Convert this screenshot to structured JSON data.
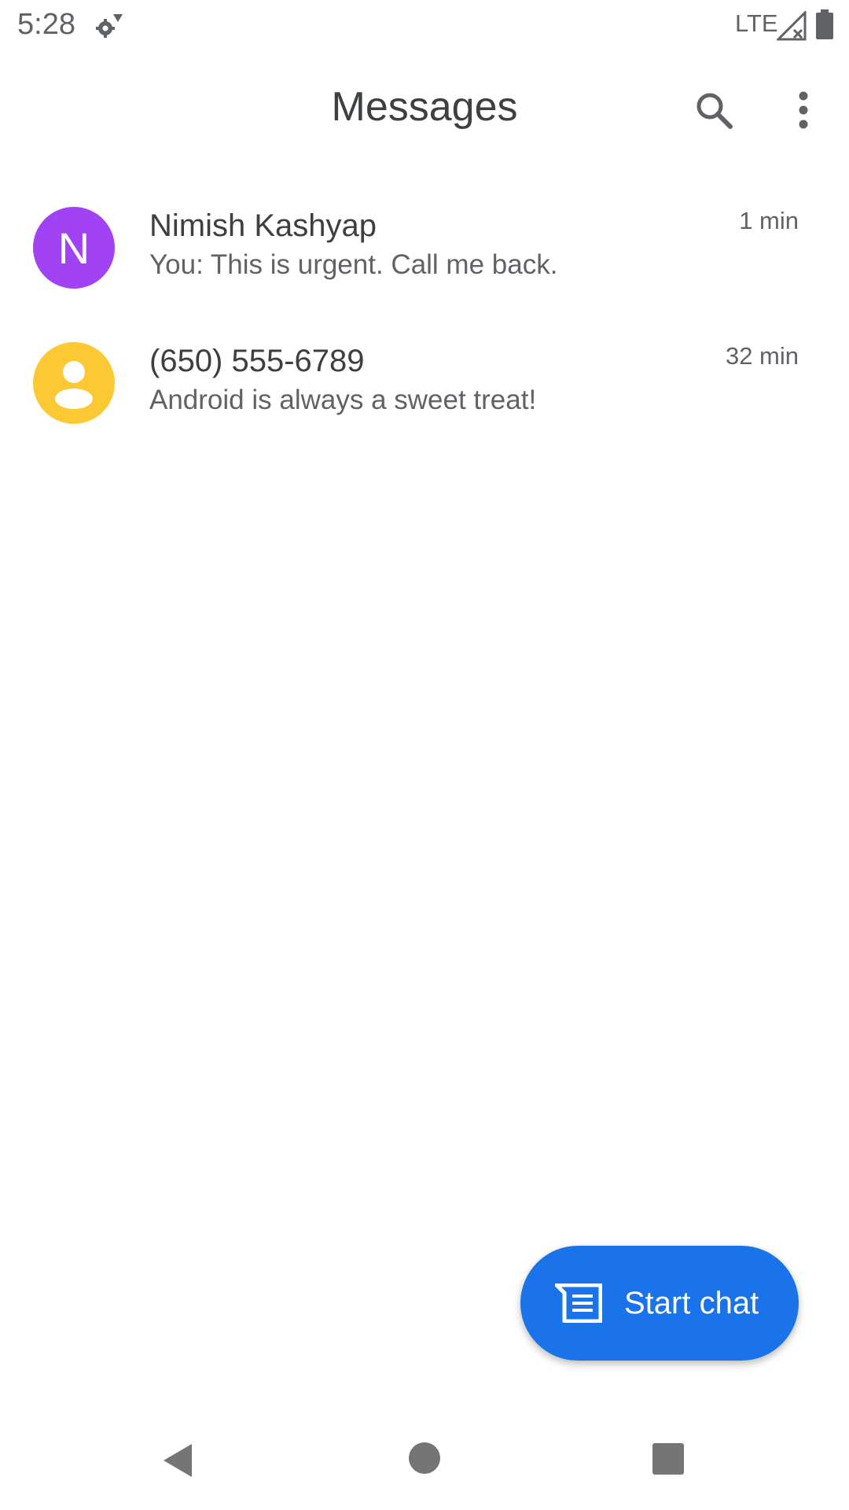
{
  "status_bar": {
    "time": "5:28",
    "network_label": "LTE",
    "icons": [
      "gear-icon",
      "signal-icon",
      "battery-icon"
    ]
  },
  "app_bar": {
    "title": "Messages",
    "icons": [
      "search-icon",
      "more-vert-icon"
    ]
  },
  "conversations": [
    {
      "avatar_letter": "N",
      "avatar_color": "#a142f4",
      "name": "Nimish Kashyap",
      "snippet": "You: This is urgent. Call me back.",
      "time": "1 min"
    },
    {
      "avatar_icon": "person-icon",
      "avatar_color": "#fcc934",
      "name": "(650) 555-6789",
      "snippet": "Android is always a sweet treat!",
      "time": "32 min"
    }
  ],
  "fab": {
    "label": "Start chat",
    "icon": "message-icon",
    "color": "#1a73e8"
  },
  "nav_bar": {
    "icons": [
      "back-icon",
      "home-icon",
      "recents-icon"
    ]
  }
}
